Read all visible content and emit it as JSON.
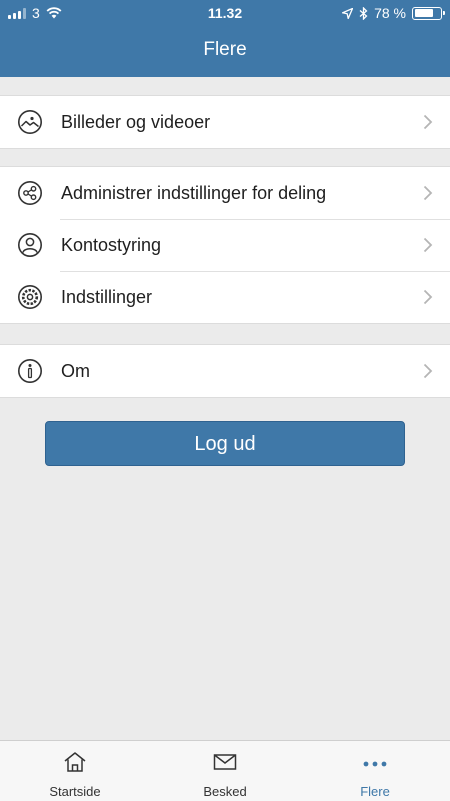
{
  "status_bar": {
    "carrier": "3",
    "time": "11.32",
    "battery_text": "78 %",
    "battery_level": 0.78
  },
  "header": {
    "title": "Flere"
  },
  "menu": {
    "photos": {
      "label": "Billeder og videoer",
      "icon": "photo-icon"
    },
    "sharing": {
      "label": "Administrer indstillinger for deling",
      "icon": "share-icon"
    },
    "account": {
      "label": "Kontostyring",
      "icon": "user-icon"
    },
    "settings": {
      "label": "Indstillinger",
      "icon": "gear-icon"
    },
    "about": {
      "label": "Om",
      "icon": "info-icon"
    }
  },
  "logout": {
    "label": "Log ud"
  },
  "tabbar": {
    "home": {
      "label": "Startside",
      "icon": "home-icon"
    },
    "messages": {
      "label": "Besked",
      "icon": "mail-icon"
    },
    "more": {
      "label": "Flere",
      "icon": "more-icon",
      "active": true
    }
  },
  "colors": {
    "accent": "#3f78a8",
    "background": "#ebebeb"
  }
}
